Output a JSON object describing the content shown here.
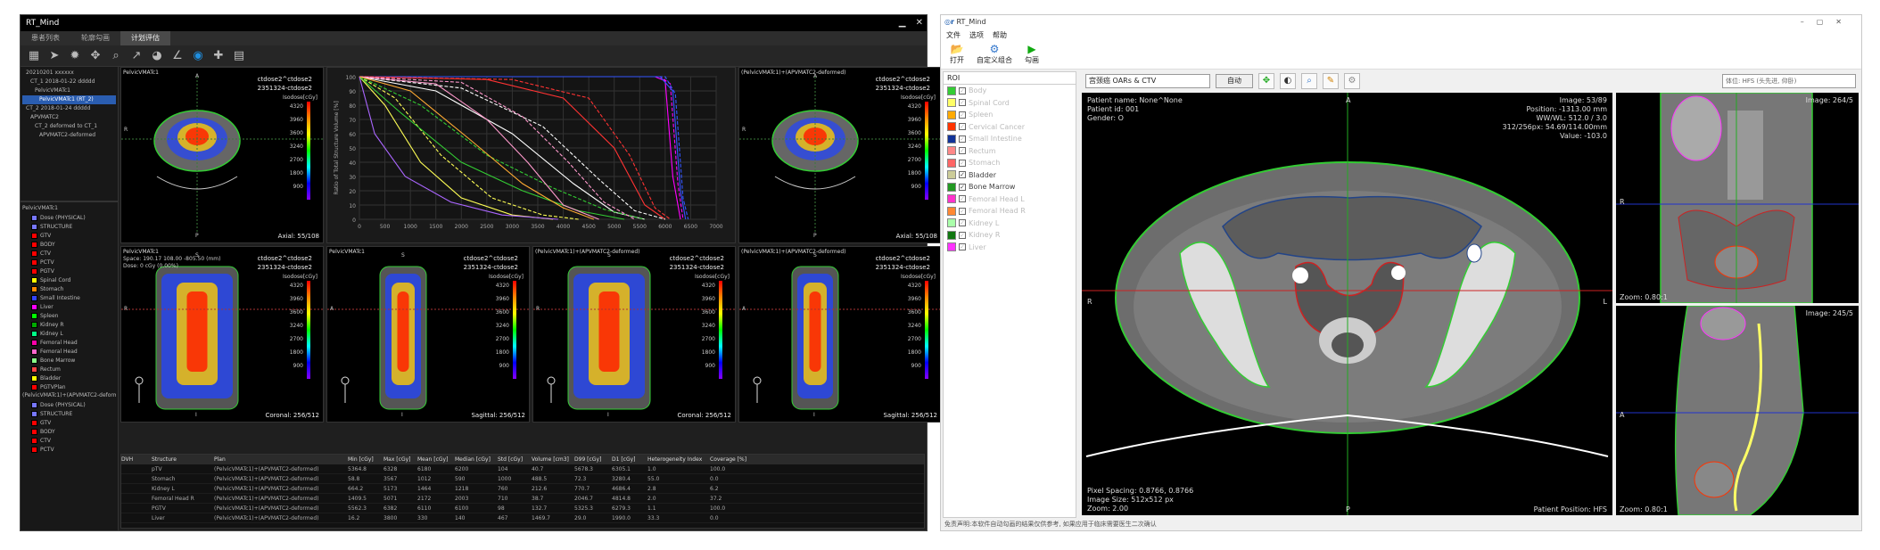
{
  "left_app": {
    "title": "RT_Mind",
    "tabs": [
      "患者列表",
      "轮廓勾画",
      "计划评估"
    ],
    "active_tab": 2,
    "tree": [
      "20210201 xxxxxx",
      "CT_1 2018-01-22 ddddd",
      "PelvicVMATc1",
      "PelvicVMATc1 (RT_2)",
      "CT_2 2018-01-24 ddddd",
      "APVMATC2",
      "CT_2 deformed to CT_1",
      "APVMATC2-deformed"
    ],
    "tree_selected": 3,
    "struct_groups": [
      {
        "name": "PelvicVMATc1",
        "items": [
          {
            "n": "Dose (PHYSICAL)",
            "c": "#7777ff"
          },
          {
            "n": "STRUCTURE",
            "c": "#7777ff"
          },
          {
            "n": "GTV",
            "c": "#ff0000"
          },
          {
            "n": "BODY",
            "c": "#ff0000"
          },
          {
            "n": "CTV",
            "c": "#ff0000"
          },
          {
            "n": "PCTV",
            "c": "#ff0000"
          },
          {
            "n": "PGTV",
            "c": "#ff0000"
          },
          {
            "n": "Spinal Cord",
            "c": "#ffff00"
          },
          {
            "n": "Stomach",
            "c": "#ff8800"
          },
          {
            "n": "Small Intestine",
            "c": "#3344ff"
          },
          {
            "n": "Liver",
            "c": "#ff00ff"
          },
          {
            "n": "Spleen",
            "c": "#00ff00"
          },
          {
            "n": "Kidney R",
            "c": "#00aa00"
          },
          {
            "n": "Kidney L",
            "c": "#00ff88"
          },
          {
            "n": "Femoral Head",
            "c": "#ff00aa"
          },
          {
            "n": "Femoral Head",
            "c": "#ff66cc"
          },
          {
            "n": "Bone Marrow",
            "c": "#88ff88"
          },
          {
            "n": "Rectum",
            "c": "#ff4444"
          },
          {
            "n": "Bladder",
            "c": "#ffff00"
          },
          {
            "n": "PGTVPlan",
            "c": "#ff0000"
          }
        ]
      },
      {
        "name": "(PelvicVMATc1)+(APVMATC2-deformed)",
        "items": [
          {
            "n": "Dose (PHYSICAL)",
            "c": "#7777ff"
          },
          {
            "n": "STRUCTURE",
            "c": "#7777ff"
          },
          {
            "n": "GTV",
            "c": "#ff0000"
          },
          {
            "n": "BODY",
            "c": "#ff0000"
          },
          {
            "n": "CTV",
            "c": "#ff0000"
          },
          {
            "n": "PCTV",
            "c": "#ff0000"
          }
        ]
      }
    ],
    "viewports": [
      {
        "name": "PelvicVMATc1",
        "id1": "ctdose2^ctdose2",
        "id2": "2351324-ctdose2",
        "view": "Axial: 55/108",
        "iso": "Isodose[cGy]",
        "kind": "axial"
      },
      {
        "name": "(PelvicVMATc1)+(APVMATC2-deformed)",
        "id1": "ctdose2^ctdose2",
        "id2": "2351324-ctdose2",
        "view": "Axial: 55/108",
        "iso": "Isodose[cGy]",
        "kind": "axial"
      },
      {
        "name": "PelvicVMATc1",
        "extra": "Space: 190.17 108.00 -805.50 (mm)",
        "extra2": "Dose: 0 cGy (0.00%)",
        "id1": "ctdose2^ctdose2",
        "id2": "2351324-ctdose2",
        "view": "Coronal: 256/512",
        "iso": "Isodose[cGy]",
        "kind": "coronal"
      },
      {
        "name": "PelvicVMATc1",
        "id1": "ctdose2^ctdose2",
        "id2": "2351324-ctdose2",
        "view": "Sagittal: 256/512",
        "iso": "Isodose[cGy]",
        "kind": "sagittal"
      },
      {
        "name": "(PelvicVMATc1)+(APVMATC2-deformed)",
        "id1": "ctdose2^ctdose2",
        "id2": "2351324-ctdose2",
        "view": "Coronal: 256/512",
        "iso": "Isodose[cGy]",
        "kind": "coronal"
      },
      {
        "name": "(PelvicVMATc1)+(APVMATC2-deformed)",
        "id1": "ctdose2^ctdose2",
        "id2": "2351324-ctdose2",
        "view": "Sagittal: 256/512",
        "iso": "Isodose[cGy]",
        "kind": "sagittal"
      }
    ],
    "iso_levels": [
      "4320",
      "3960",
      "3600",
      "3240",
      "2700",
      "1800",
      "900"
    ],
    "dvh_ylabel": "Ratio of Total Structure Volume [%]",
    "table_headers": [
      "DVH",
      "Structure",
      "Plan",
      "Min [cGy]",
      "Max [cGy]",
      "Mean [cGy]",
      "Median [cGy]",
      "Std [cGy]",
      "Volume [cm3]",
      "D99 [cGy]",
      "D1 [cGy]",
      "Heterogeneity Index",
      "Coverage [%]"
    ],
    "table_rows": [
      [
        "",
        "pTV",
        "(PelvicVMATc1)+(APVMATC2-deformed)",
        "5364.8",
        "6328",
        "6180",
        "6200",
        "104",
        "40.7",
        "5678.3",
        "6305.1",
        "1.0",
        "100.0"
      ],
      [
        "",
        "Stomach",
        "(PelvicVMATc1)+(APVMATC2-deformed)",
        "58.8",
        "3567",
        "1012",
        "590",
        "1000",
        "488.5",
        "72.3",
        "3280.4",
        "55.0",
        "0.0"
      ],
      [
        "",
        "Kidney L",
        "(PelvicVMATc1)+(APVMATC2-deformed)",
        "664.2",
        "5173",
        "1464",
        "1218",
        "760",
        "212.6",
        "770.7",
        "4686.4",
        "2.8",
        "6.2"
      ],
      [
        "",
        "Femoral Head R",
        "(PelvicVMATc1)+(APVMATC2-deformed)",
        "1409.5",
        "5071",
        "2172",
        "2003",
        "710",
        "38.7",
        "2046.7",
        "4814.8",
        "2.0",
        "37.2"
      ],
      [
        "",
        "PGTV",
        "(PelvicVMATc1)+(APVMATC2-deformed)",
        "5562.3",
        "6382",
        "6110",
        "6100",
        "98",
        "132.7",
        "5325.3",
        "6279.3",
        "1.1",
        "100.0"
      ],
      [
        "",
        "Liver",
        "(PelvicVMATc1)+(APVMATC2-deformed)",
        "16.2",
        "3800",
        "330",
        "140",
        "467",
        "1469.7",
        "29.0",
        "1990.0",
        "33.3",
        "0.0"
      ]
    ]
  },
  "dvh_chart": {
    "type": "line",
    "x_ticks": [
      "0",
      "500",
      "1000",
      "1500",
      "2000",
      "2500",
      "3000",
      "3500",
      "4000",
      "4500",
      "5000",
      "5500",
      "6000",
      "6500",
      "7000"
    ],
    "y_ticks": [
      "0",
      "10",
      "20",
      "30",
      "40",
      "50",
      "60",
      "70",
      "80",
      "90",
      "100"
    ],
    "xlim": [
      0,
      7000
    ],
    "ylim": [
      0,
      100
    ],
    "ylabel": "Ratio of Total Structure Volume [%]",
    "series": [
      {
        "color": "#ff00ff",
        "dash": false,
        "x": [
          0,
          5800,
          6000,
          6150,
          6300
        ],
        "y": [
          100,
          100,
          97,
          30,
          0
        ]
      },
      {
        "color": "#ff00ff",
        "dash": true,
        "x": [
          0,
          5900,
          6100,
          6250,
          6350
        ],
        "y": [
          100,
          100,
          95,
          25,
          0
        ]
      },
      {
        "color": "#3355ff",
        "dash": false,
        "x": [
          0,
          5900,
          6150,
          6300,
          6400
        ],
        "y": [
          100,
          100,
          90,
          20,
          0
        ]
      },
      {
        "color": "#3355ff",
        "dash": true,
        "x": [
          0,
          6000,
          6200,
          6350,
          6450
        ],
        "y": [
          100,
          100,
          88,
          15,
          0
        ]
      },
      {
        "color": "#ff3333",
        "dash": false,
        "x": [
          0,
          2500,
          4000,
          5000,
          5600,
          6000
        ],
        "y": [
          100,
          98,
          85,
          50,
          10,
          0
        ]
      },
      {
        "color": "#ff3333",
        "dash": true,
        "x": [
          0,
          3000,
          4500,
          5300,
          5800,
          6100
        ],
        "y": [
          100,
          98,
          85,
          45,
          8,
          0
        ]
      },
      {
        "color": "#ffffff",
        "dash": false,
        "x": [
          0,
          1500,
          3000,
          4200,
          5000,
          5600
        ],
        "y": [
          100,
          90,
          60,
          25,
          5,
          0
        ]
      },
      {
        "color": "#ffffff",
        "dash": true,
        "x": [
          0,
          2000,
          3600,
          4700,
          5400,
          6000
        ],
        "y": [
          100,
          92,
          65,
          28,
          6,
          0
        ]
      },
      {
        "color": "#ffff55",
        "dash": false,
        "x": [
          0,
          500,
          1200,
          2000,
          3000,
          3800
        ],
        "y": [
          100,
          80,
          40,
          15,
          3,
          0
        ]
      },
      {
        "color": "#ffff55",
        "dash": true,
        "x": [
          0,
          700,
          1600,
          2600,
          3600,
          4300
        ],
        "y": [
          100,
          85,
          45,
          15,
          3,
          0
        ]
      },
      {
        "color": "#33cc33",
        "dash": false,
        "x": [
          0,
          800,
          2000,
          3200,
          4300,
          5200
        ],
        "y": [
          100,
          75,
          40,
          20,
          6,
          0
        ]
      },
      {
        "color": "#33cc33",
        "dash": true,
        "x": [
          0,
          1200,
          2500,
          3800,
          4800,
          5600
        ],
        "y": [
          100,
          80,
          45,
          22,
          7,
          0
        ]
      },
      {
        "color": "#ff99cc",
        "dash": false,
        "x": [
          0,
          1500,
          2500,
          3300,
          4000,
          4700
        ],
        "y": [
          100,
          95,
          70,
          40,
          10,
          0
        ]
      },
      {
        "color": "#ff99cc",
        "dash": true,
        "x": [
          0,
          2000,
          3200,
          4100,
          4800,
          5400
        ],
        "y": [
          100,
          96,
          72,
          40,
          12,
          0
        ]
      },
      {
        "color": "#aa66ff",
        "dash": false,
        "x": [
          0,
          300,
          900,
          1800,
          2800,
          3900
        ],
        "y": [
          100,
          60,
          30,
          12,
          3,
          0
        ]
      },
      {
        "color": "#ffaa33",
        "dash": false,
        "x": [
          0,
          1000,
          2200,
          3200,
          4000,
          4600
        ],
        "y": [
          100,
          90,
          55,
          25,
          8,
          0
        ]
      }
    ]
  },
  "right_app": {
    "title": "RT_Mind",
    "menu": [
      "文件",
      "选项",
      "帮助"
    ],
    "ribbon": [
      {
        "icon": "📂",
        "label": "打开"
      },
      {
        "icon": "⚙",
        "label": "自定义组合"
      },
      {
        "icon": "▶",
        "label": "勾画"
      }
    ],
    "roi_tab": "ROI",
    "rois": [
      {
        "n": "Body",
        "c": "#33cc33",
        "dim": true
      },
      {
        "n": "Spinal Cord",
        "c": "#ffff66",
        "dim": true
      },
      {
        "n": "Spleen",
        "c": "#ffaa00",
        "dim": true
      },
      {
        "n": "Cervical Cancer",
        "c": "#ff3300",
        "dim": true
      },
      {
        "n": "Small Intestine",
        "c": "#113399",
        "dim": true
      },
      {
        "n": "Rectum",
        "c": "#ff8888",
        "dim": true
      },
      {
        "n": "Stomach",
        "c": "#ff6666",
        "dim": true
      },
      {
        "n": "Bladder",
        "c": "#cccc99",
        "dim": false
      },
      {
        "n": "Bone Marrow",
        "c": "#229922",
        "dim": false
      },
      {
        "n": "Femoral Head L",
        "c": "#ff33cc",
        "dim": true
      },
      {
        "n": "Femoral Head R",
        "c": "#ff8833",
        "dim": true
      },
      {
        "n": "Kidney L",
        "c": "#aaffaa",
        "dim": true
      },
      {
        "n": "Kidney R",
        "c": "#117711",
        "dim": true
      },
      {
        "n": "Liver",
        "c": "#ff33ff",
        "dim": true
      }
    ],
    "model_select": "宫颈癌 OARs & CTV",
    "auto_btn": "自动",
    "right_select": "体位: HFS (头先进, 仰卧)",
    "info_left": [
      "Patient name: None^None",
      "Patient id: 001",
      "Gender: O"
    ],
    "info_right": [
      "Image: 53/89",
      "Position: -1313.00 mm",
      "WW/WL: 512.0 / 3.0",
      "312/256px: 54.69/114.00mm",
      "Value: -103.0"
    ],
    "bottom_left": [
      "Pixel Spacing: 0.8766, 0.8766",
      "Image Size: 512x512 px",
      "Zoom: 2.00"
    ],
    "bottom_right": "Patient Position: HFS",
    "cor_image": "Image: 264/5",
    "sag_image": "Image: 245/5",
    "zoom_small": "Zoom: 0.80:1",
    "status": "免责声明:本软件自动勾画的结果仅供参考, 如果应用于临床需要医生二次确认"
  },
  "orient": {
    "a": "A",
    "p": "P",
    "r": "R",
    "l": "L",
    "s": "S",
    "i": "I"
  }
}
